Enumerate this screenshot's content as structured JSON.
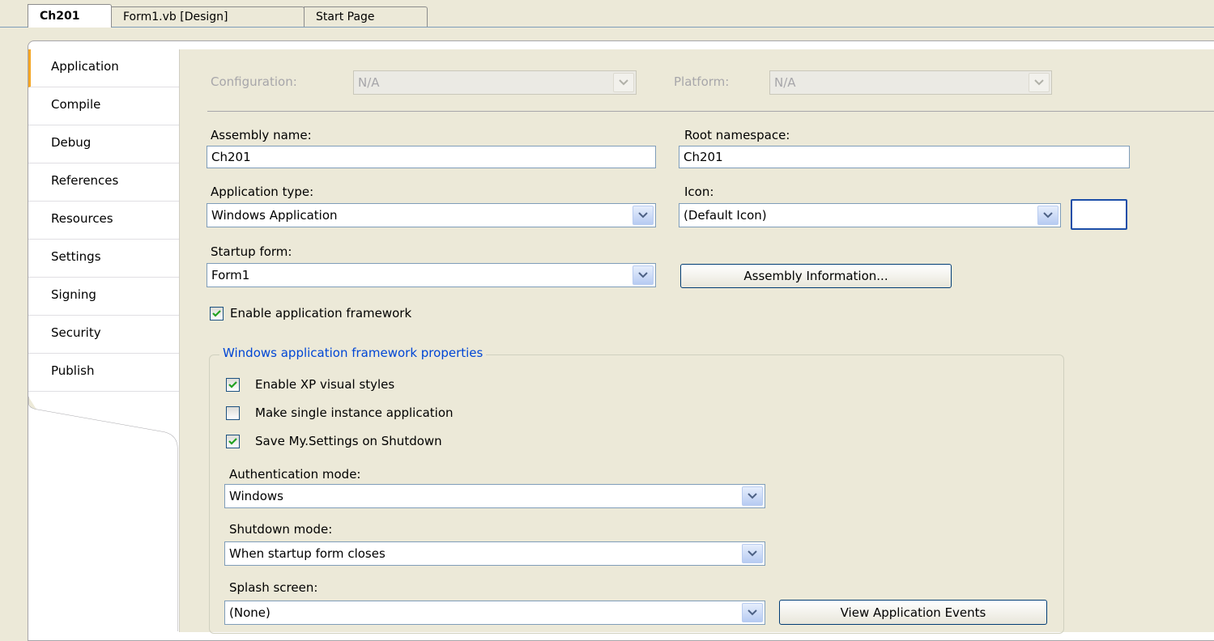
{
  "doc_tabs": [
    {
      "label": "Ch201",
      "active": true
    },
    {
      "label": "Form1.vb [Design]",
      "active": false
    },
    {
      "label": "Start Page",
      "active": false
    }
  ],
  "nav": {
    "items": [
      {
        "label": "Application",
        "selected": true
      },
      {
        "label": "Compile"
      },
      {
        "label": "Debug"
      },
      {
        "label": "References"
      },
      {
        "label": "Resources"
      },
      {
        "label": "Settings"
      },
      {
        "label": "Signing"
      },
      {
        "label": "Security"
      },
      {
        "label": "Publish"
      }
    ]
  },
  "config": {
    "configuration_label": "Configuration:",
    "configuration_value": "N/A",
    "platform_label": "Platform:",
    "platform_value": "N/A"
  },
  "form": {
    "assembly_name_label": "Assembly name:",
    "assembly_name_value": "Ch201",
    "root_namespace_label": "Root namespace:",
    "root_namespace_value": "Ch201",
    "application_type_label": "Application type:",
    "application_type_value": "Windows Application",
    "icon_label": "Icon:",
    "icon_value": "(Default Icon)",
    "startup_form_label": "Startup form:",
    "startup_form_value": "Form1",
    "assembly_info_button": "Assembly Information...",
    "enable_framework_label": "Enable application framework",
    "enable_framework_checked": true
  },
  "framework": {
    "title": "Windows application framework properties",
    "xp_styles_label": "Enable XP visual styles",
    "xp_styles_checked": true,
    "single_instance_label": "Make single instance application",
    "single_instance_checked": false,
    "save_settings_label": "Save My.Settings on Shutdown",
    "save_settings_checked": true,
    "auth_mode_label": "Authentication mode:",
    "auth_mode_value": "Windows",
    "shutdown_mode_label": "Shutdown mode:",
    "shutdown_mode_value": "When startup form closes",
    "splash_label": "Splash screen:",
    "splash_value": "(None)",
    "view_events_button": "View Application Events"
  },
  "colors": {
    "window_bg": "#ECE9D8",
    "group_title": "#0046D5",
    "check_mark": "#21A121",
    "selected_tab_accent": "#F5A623"
  }
}
